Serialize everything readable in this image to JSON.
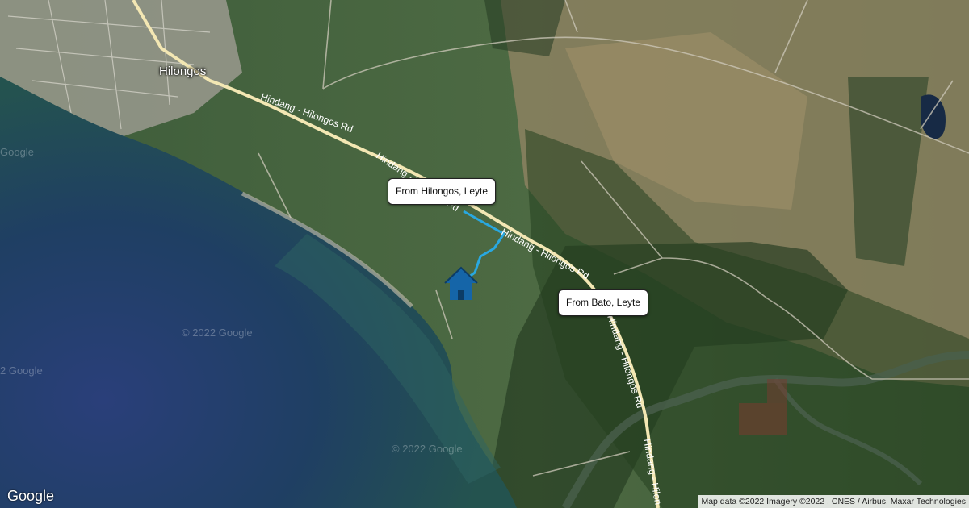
{
  "map": {
    "town_label": "Hilongos",
    "road_labels": [
      "Hindang - Hilongos Rd",
      "Hindang - Hilongos Rd",
      "Hindang - Hilongos Rd",
      "Hindang - Hilongos Rd",
      "Hindang - Hilon"
    ],
    "callouts": {
      "hilongos": "From Hilongos, Leyte",
      "bato": "From Bato, Leyte"
    },
    "watermarks": [
      "Google",
      "© 2022 Google",
      "2 Google",
      "© 2022 Google"
    ],
    "marker_icon": "home-icon",
    "route_color": "#29a8e0",
    "marker_color": "#1565a8"
  },
  "footer": {
    "logo": "Google",
    "attribution": "Map data ©2022 Imagery ©2022 , CNES / Airbus, Maxar Technologies"
  }
}
